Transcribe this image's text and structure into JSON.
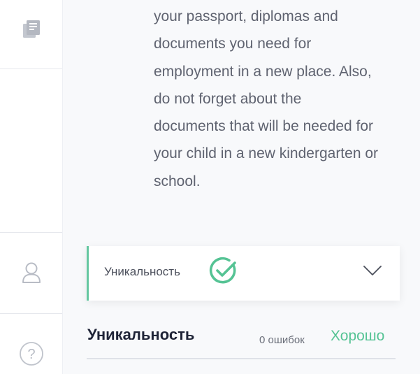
{
  "sidebar": {
    "icons": [
      "library-icon",
      "user-icon",
      "help-icon"
    ],
    "help_label": "?"
  },
  "article": {
    "lines": [
      "your passport, diplomas and",
      "documents you need for",
      "employment in a new place. Also,",
      "do not forget about the",
      "documents that will be needed for",
      "your child in a new kindergarten or",
      "school."
    ]
  },
  "uniqueness_panel": {
    "title": "Уникальность",
    "check_icon": "check-circle-icon",
    "expand_icon": "chevron-down-icon"
  },
  "summary": {
    "title": "Уникальность",
    "errors": "0 ошибок",
    "status": "Хорошо"
  },
  "colors": {
    "accent_green": "#55c394",
    "panel_border": "#64c7a0",
    "heading_text": "#1f2437",
    "body_text": "#5f6370",
    "icon_gray": "#b8bcc5"
  }
}
